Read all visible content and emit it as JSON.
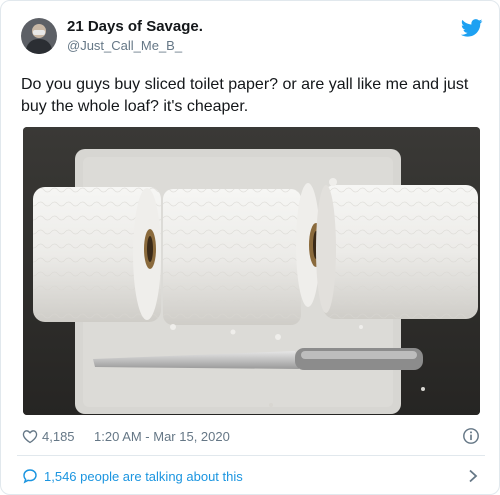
{
  "tweet": {
    "author_name": "21 Days of Savage.",
    "author_handle": "@Just_Call_Me_B_",
    "text": "Do you guys buy sliced toilet paper? or are yall like me and just buy the whole loaf? it's cheaper.",
    "likes": "4,185",
    "timestamp": "1:20 AM - Mar 15, 2020",
    "conversation_label": "1,546 people are talking about this"
  },
  "icons": {
    "brand": "twitter-bird-icon",
    "like": "heart-icon",
    "info": "info-icon",
    "conversation": "speech-bubble-icon",
    "more": "chevron-right-icon"
  },
  "colors": {
    "brand_blue": "#1da1f2",
    "link_blue": "#1b95e0",
    "secondary_text": "#657786",
    "border": "#e1e8ed"
  }
}
